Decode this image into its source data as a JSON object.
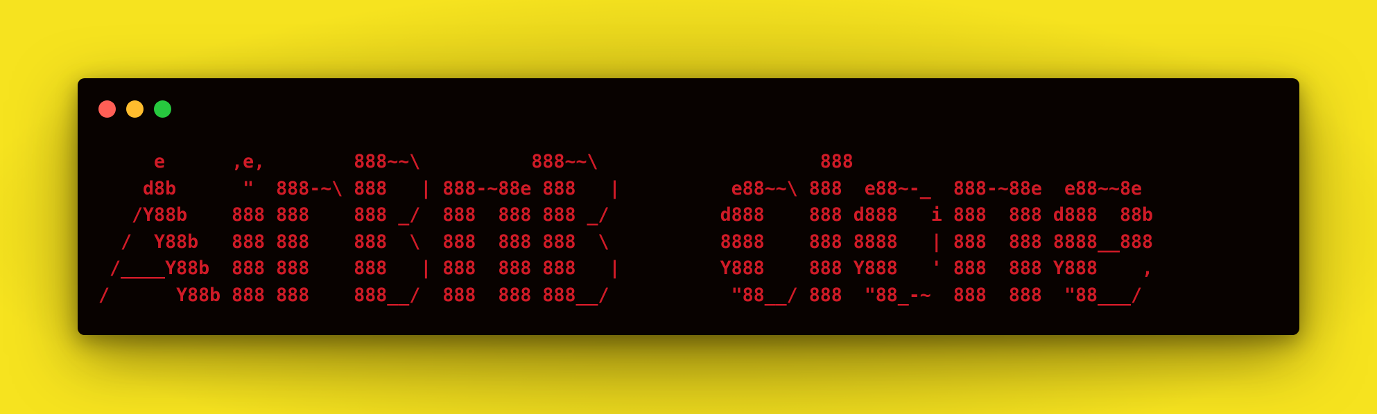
{
  "window": {
    "controls": [
      {
        "name": "close",
        "color": "#ff5f56"
      },
      {
        "name": "minimize",
        "color": "#ffbd2e"
      },
      {
        "name": "zoom",
        "color": "#27c93f"
      }
    ],
    "background": "#080200"
  },
  "page": {
    "background": "#f6e31f"
  },
  "terminal": {
    "text_color": "#d01b27",
    "lines": [
      "     e      ,e,        888~~\\          888~~\\                    888",
      "    d8b      \"  888-~\\ 888   | 888-~88e 888   |          e88~~\\ 888  e88~-_  888-~88e  e88~~8e",
      "   /Y88b    888 888    888 _/  888  888 888 _/          d888    888 d888   i 888  888 d888  88b",
      "  /  Y88b   888 888    888  \\  888  888 888  \\          8888    888 8888   | 888  888 8888__888",
      " /____Y88b  888 888    888   | 888  888 888   |         Y888    888 Y888   ' 888  888 Y888    ,",
      "/      Y88b 888 888    888__/  888  888 888__/           \"88__/ 888  \"88_-~  888  888  \"88___/"
    ]
  }
}
